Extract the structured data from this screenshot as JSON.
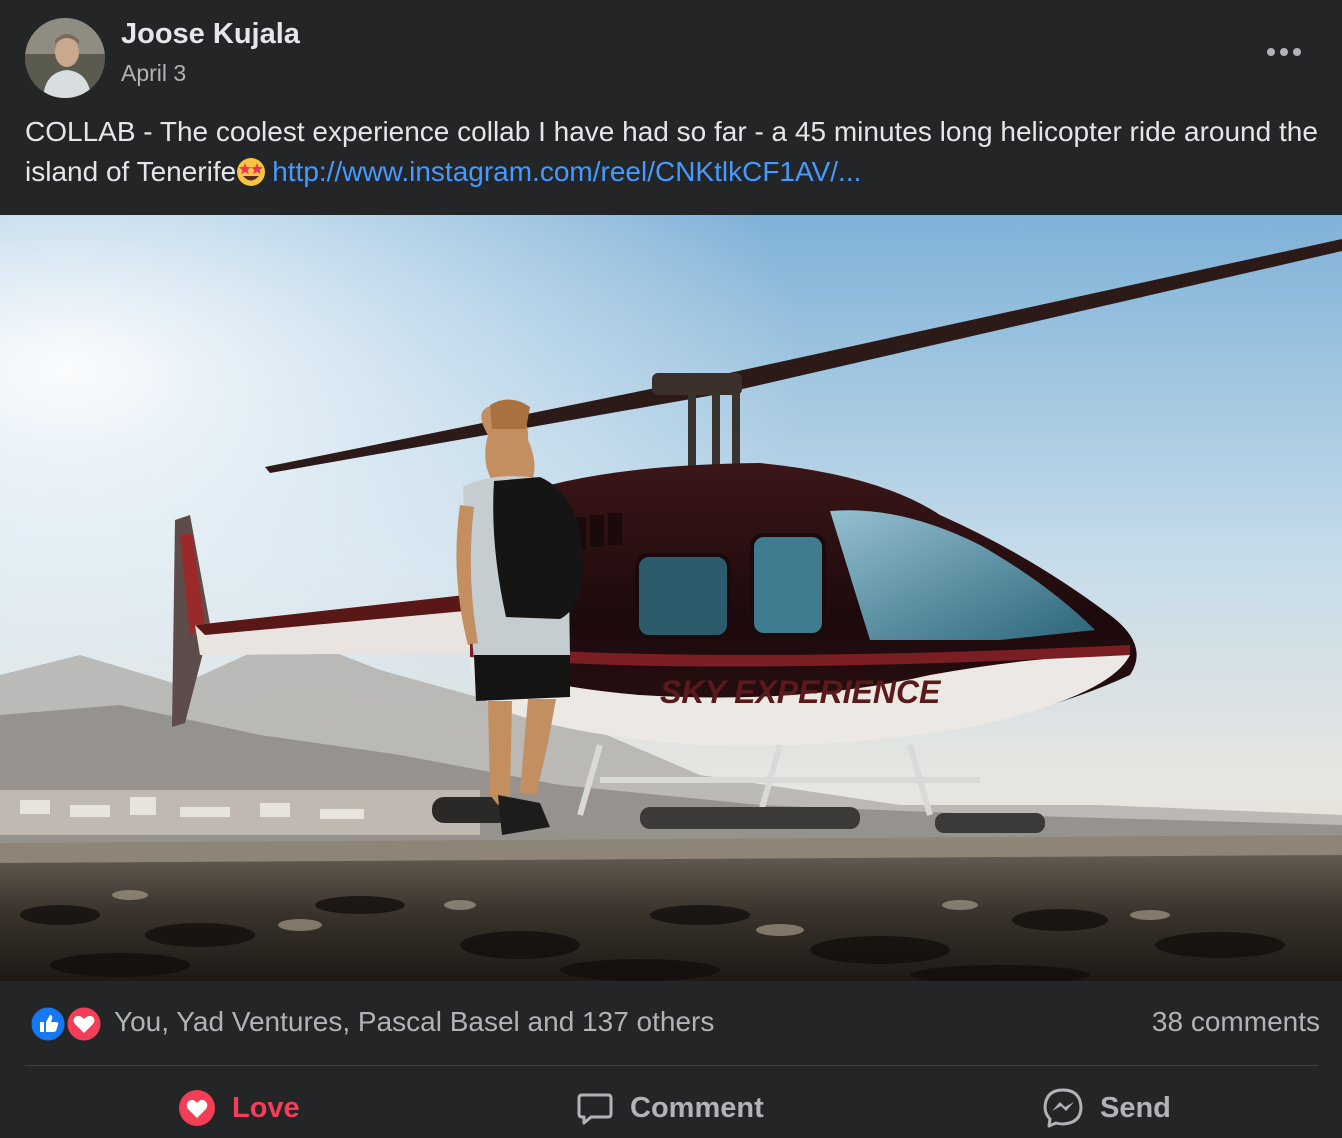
{
  "post": {
    "author": "Joose Kujala",
    "date": "April 3",
    "caption_text": "COLLAB - The coolest experience collab I have had so far - a 45 minutes long helicopter ride around the island of Tenerife",
    "caption_emoji": "star-struck-emoji",
    "caption_link": "http://www.instagram.com/reel/CNKtlkCF1AV/...",
    "photo_brand_text": "SKY EXPERIENCE"
  },
  "reactions": {
    "icons": [
      "like-icon",
      "love-icon"
    ],
    "reactors": "You, Yad Ventures, Pascal Basel and 137 others",
    "comments": "38 comments"
  },
  "actions": {
    "love_label": "Love",
    "comment_label": "Comment",
    "send_label": "Send"
  },
  "colors": {
    "background": "#242526",
    "text_primary": "#e4e6eb",
    "text_secondary": "#b0b3b8",
    "link": "#4599ff",
    "love": "#f33e58",
    "like": "#1877f2"
  }
}
